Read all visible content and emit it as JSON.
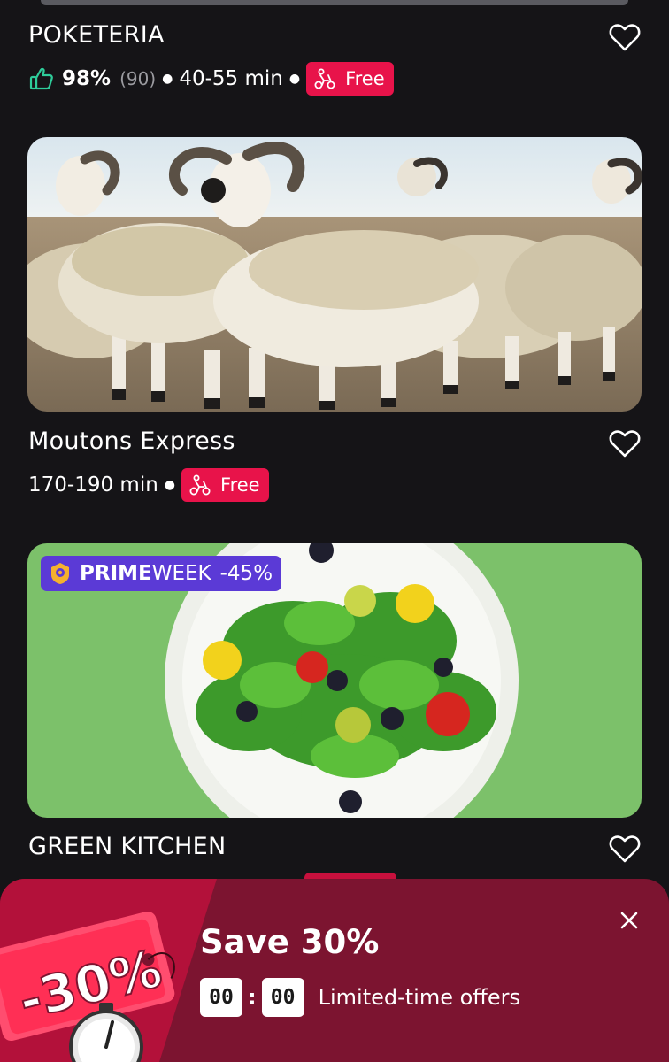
{
  "stores": [
    {
      "name": "POKETERIA",
      "rating": "98%",
      "rating_count": "(90)",
      "eta": "40-55 min",
      "delivery": "Free"
    },
    {
      "name": "Moutons Express",
      "eta": "170-190 min",
      "delivery": "Free"
    },
    {
      "name": "GREEN KITCHEN",
      "promo_badge": {
        "part1": "PRIME",
        "part2": "WEEK",
        "discount": "-45%"
      }
    }
  ],
  "promo": {
    "tag": "-30%",
    "title": "Save 30%",
    "timer_minutes": "00",
    "timer_seconds": "00",
    "subtitle": "Limited-time offers"
  },
  "colors": {
    "background": "#151417",
    "free_badge": "#e8134a",
    "prime_badge": "#5b3ad6",
    "promo_banner": "#7c1430"
  },
  "icons": [
    "heart-outline-icon",
    "thumbs-up-icon",
    "delivery-scooter-icon",
    "prime-crown-icon",
    "close-icon",
    "stopwatch-icon"
  ]
}
